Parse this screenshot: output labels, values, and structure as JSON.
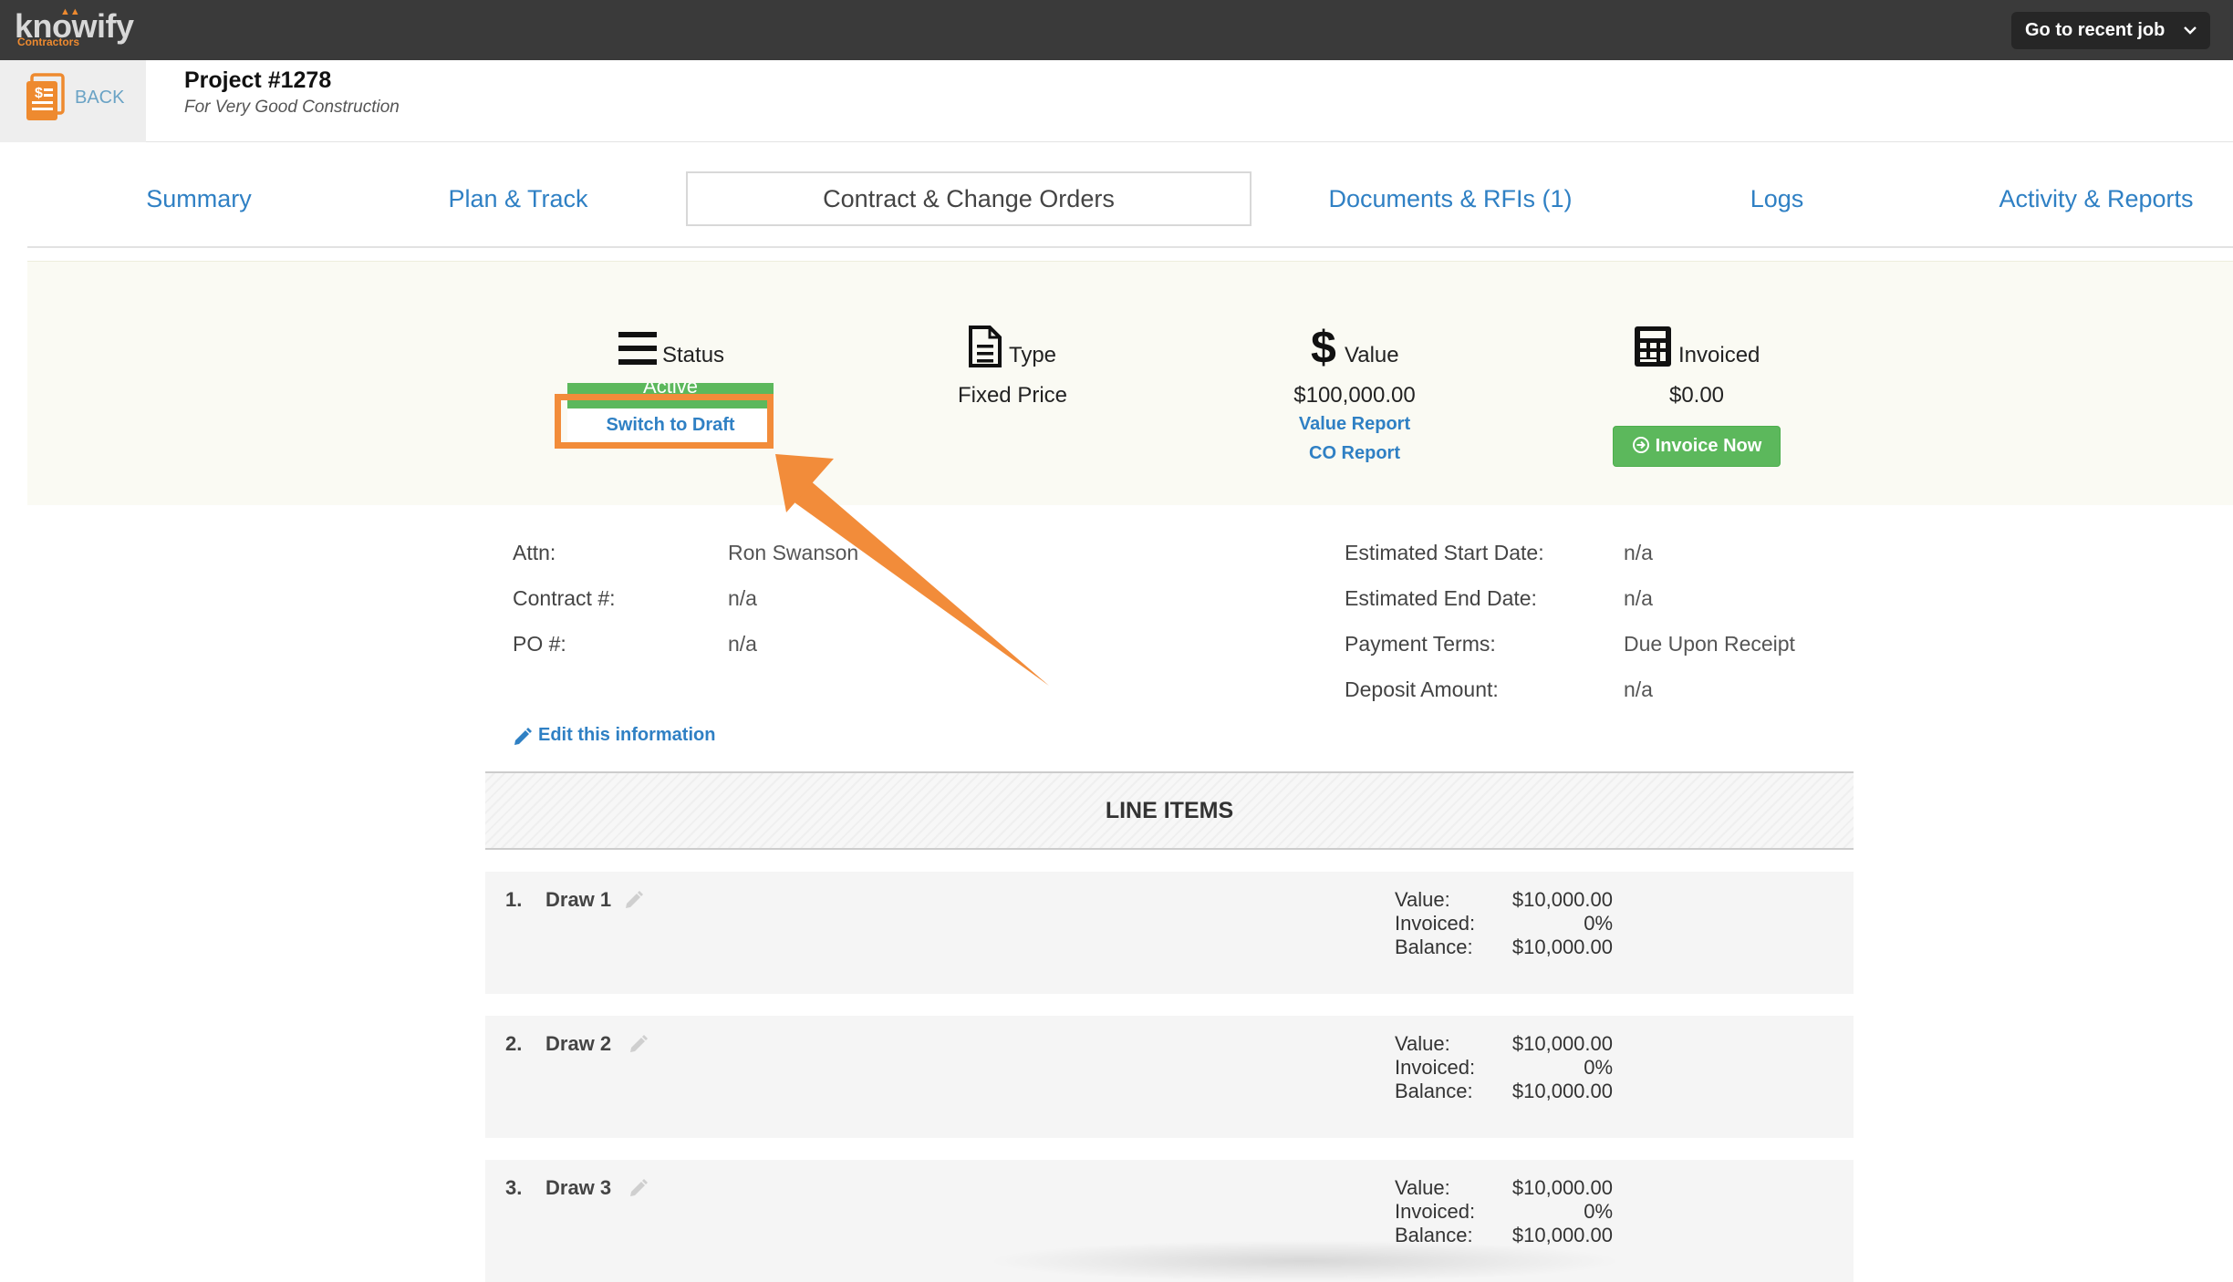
{
  "topbar": {
    "logo_text": "knowify",
    "logo_sub": "Contractors",
    "recent_job_label": "Go to recent job"
  },
  "header": {
    "back_label": "BACK",
    "project_title": "Project #1278",
    "project_subtitle": "For Very Good Construction"
  },
  "tabs": [
    {
      "label": "Summary",
      "active": false
    },
    {
      "label": "Plan & Track",
      "active": false
    },
    {
      "label": "Contract & Change Orders",
      "active": true
    },
    {
      "label": "Documents & RFIs (1)",
      "active": false
    },
    {
      "label": "Logs",
      "active": false
    },
    {
      "label": "Activity & Reports",
      "active": false
    }
  ],
  "summary": {
    "status": {
      "label": "Status",
      "value": "Active",
      "switch_label": "Switch to Draft"
    },
    "type": {
      "label": "Type",
      "value": "Fixed Price"
    },
    "value": {
      "label": "Value",
      "amount": "$100,000.00",
      "value_report": "Value Report",
      "co_report": "CO Report"
    },
    "invoiced": {
      "label": "Invoiced",
      "amount": "$0.00",
      "button": "Invoice Now"
    }
  },
  "details_left": [
    {
      "label": "Attn:",
      "value": "Ron Swanson"
    },
    {
      "label": "Contract #:",
      "value": "n/a"
    },
    {
      "label": "PO #:",
      "value": "n/a"
    }
  ],
  "details_right": [
    {
      "label": "Estimated Start Date:",
      "value": "n/a"
    },
    {
      "label": "Estimated End Date:",
      "value": "n/a"
    },
    {
      "label": "Payment Terms:",
      "value": "Due Upon Receipt"
    },
    {
      "label": "Deposit Amount:",
      "value": "n/a"
    }
  ],
  "edit_label": "Edit this information",
  "line_items": {
    "title": "LINE ITEMS",
    "value_label": "Value:",
    "invoiced_label": "Invoiced:",
    "balance_label": "Balance:",
    "items": [
      {
        "num": "1.",
        "name": "Draw 1",
        "value": "$10,000.00",
        "invoiced": "0%",
        "balance": "$10,000.00"
      },
      {
        "num": "2.",
        "name": "Draw 2",
        "value": "$10,000.00",
        "invoiced": "0%",
        "balance": "$10,000.00"
      },
      {
        "num": "3.",
        "name": "Draw 3",
        "value": "$10,000.00",
        "invoiced": "0%",
        "balance": "$10,000.00"
      }
    ]
  },
  "colors": {
    "topbar": "#3a3a3a",
    "link": "#2f80c4",
    "accent_orange": "#f28c3a",
    "success_green": "#5cb85c",
    "panel_bg": "#fafaf3"
  },
  "icons": [
    "document-dollar-icon",
    "hamburger-icon",
    "file-icon",
    "dollar-icon",
    "calculator-icon",
    "circle-arrow-icon",
    "pencil-icon",
    "chevron-down-icon"
  ]
}
